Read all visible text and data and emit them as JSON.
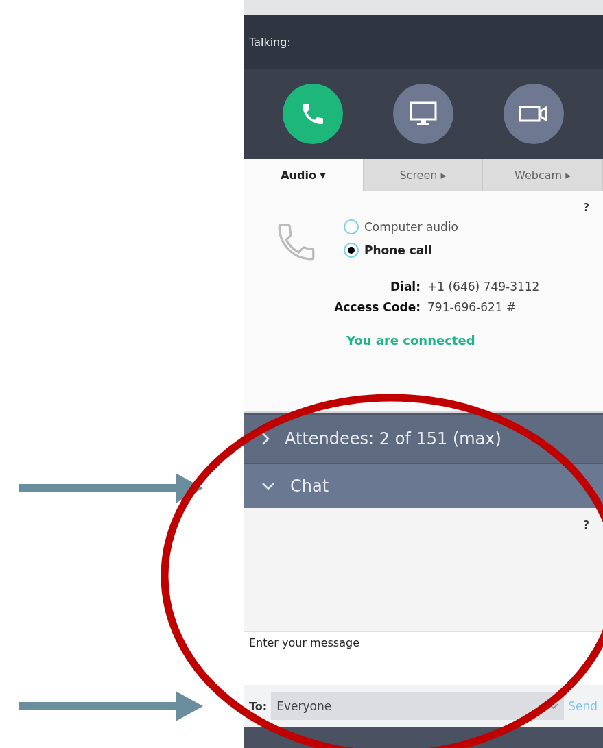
{
  "header": {
    "title": "Talking:"
  },
  "call_buttons": [
    {
      "kind": "phone",
      "on": true
    },
    {
      "kind": "screen",
      "on": false
    },
    {
      "kind": "webcam",
      "on": false
    }
  ],
  "tabs": [
    {
      "label": "Audio",
      "caret": "▾",
      "selected": true
    },
    {
      "label": "Screen",
      "caret": "▸",
      "selected": false
    },
    {
      "label": "Webcam",
      "caret": "▸",
      "selected": false
    }
  ],
  "audio": {
    "help": "?",
    "options": [
      {
        "label": "Computer audio",
        "selected": false
      },
      {
        "label": "Phone call",
        "selected": true
      }
    ],
    "details": [
      {
        "label": "Dial:",
        "value": "+1 (646) 749-3112"
      },
      {
        "label": "Access Code:",
        "value": "791-696-621 #"
      }
    ],
    "status": "You are connected"
  },
  "sections": [
    {
      "label": "Attendees:  2 of 151 (max)",
      "expanded": false
    },
    {
      "label": "Chat",
      "expanded": true
    }
  ],
  "chat": {
    "help": "?",
    "message_placeholder": "Enter your message",
    "to_label": "To:",
    "recipient": "Everyone",
    "send": "Send"
  },
  "annotations": [
    {
      "kind": "arrow"
    },
    {
      "kind": "arrow"
    },
    {
      "kind": "ellipse"
    }
  ]
}
